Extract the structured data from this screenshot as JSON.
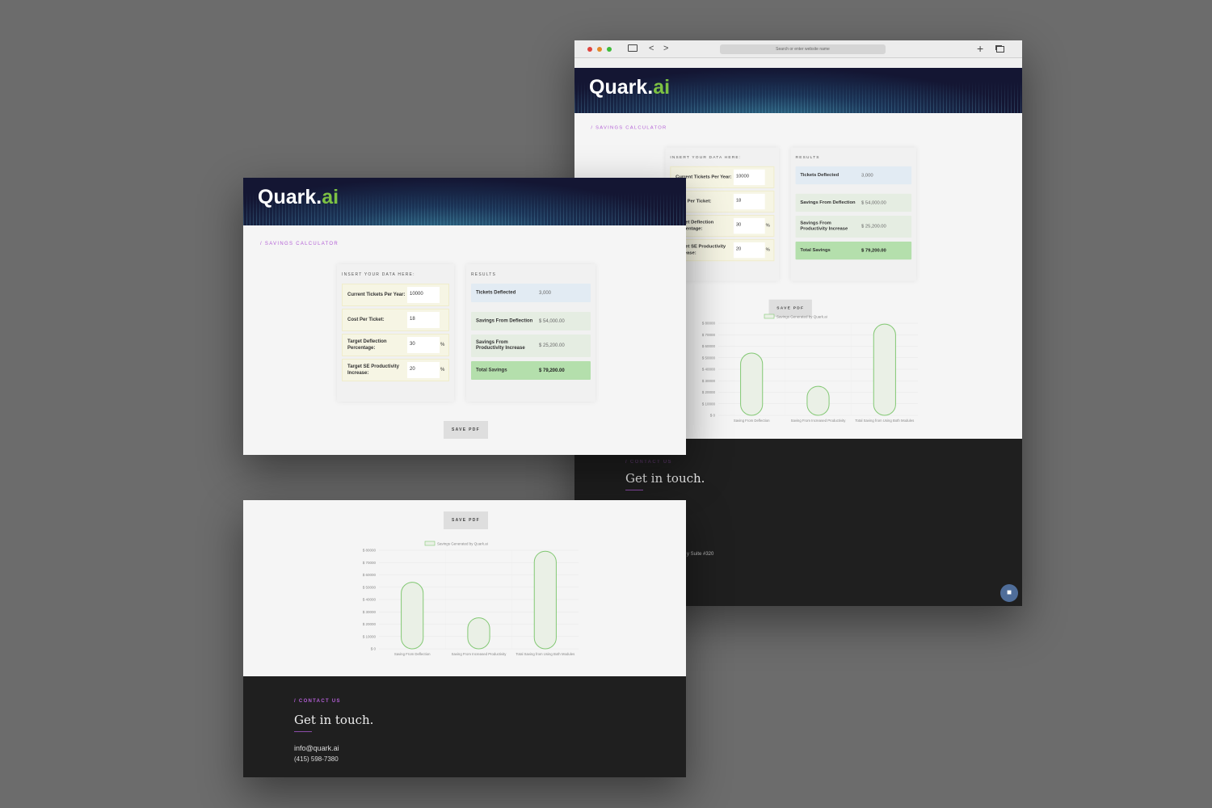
{
  "browser": {
    "url_placeholder": "Search or enter website name",
    "back": "<",
    "forward": ">",
    "new_tab": "+"
  },
  "brand": {
    "logo_main": "Quark.",
    "logo_accent": "ai"
  },
  "section_label": "/ SAVINGS CALCULATOR",
  "inputs": {
    "heading": "INSERT YOUR DATA HERE:",
    "rows": [
      {
        "label": "Current Tickets Per Year:",
        "value": "10000",
        "unit": ""
      },
      {
        "label": "Cost Per Ticket:",
        "value": "18",
        "unit": ""
      },
      {
        "label": "Target Deflection Percentage:",
        "value": "30",
        "unit": "%"
      },
      {
        "label": "Target SE Productivity Increase:",
        "value": "20",
        "unit": "%"
      }
    ]
  },
  "results": {
    "heading": "RESULTS",
    "tickets_deflected": {
      "label": "Tickets Deflected",
      "value": "3,000"
    },
    "savings_deflection": {
      "label": "Savings From Deflection",
      "value": "$ 54,000.00"
    },
    "savings_productivity": {
      "label": "Savings From Productivity Increase",
      "value": "$ 25,200.00"
    },
    "total": {
      "label": "Total Savings",
      "value": "$ 79,200.00"
    }
  },
  "save_pdf": "SAVE PDF",
  "chart_data": {
    "type": "bar",
    "title": "",
    "legend": [
      "Savings Generated by Quark.ai"
    ],
    "legend_position": "top",
    "categories": [
      "Saving From Deflection",
      "Saving From Increased Productivity",
      "Total Saving from Using Both Modules"
    ],
    "values": [
      54000,
      25200,
      79200
    ],
    "ylim": [
      0,
      80000
    ],
    "yticks": [
      "$ 0",
      "$ 10000",
      "$ 20000",
      "$ 30000",
      "$ 40000",
      "$ 50000",
      "$ 60000",
      "$ 70000",
      "$ 80000"
    ],
    "colors": {
      "stroke": "#82c873",
      "fill": "#eaf0e6"
    }
  },
  "contact": {
    "label": "/ CONTACT US",
    "title": "Get in touch.",
    "email": "info@quark.ai",
    "phone": "(415) 598-7380",
    "address_fragment": "y Suite #320"
  }
}
